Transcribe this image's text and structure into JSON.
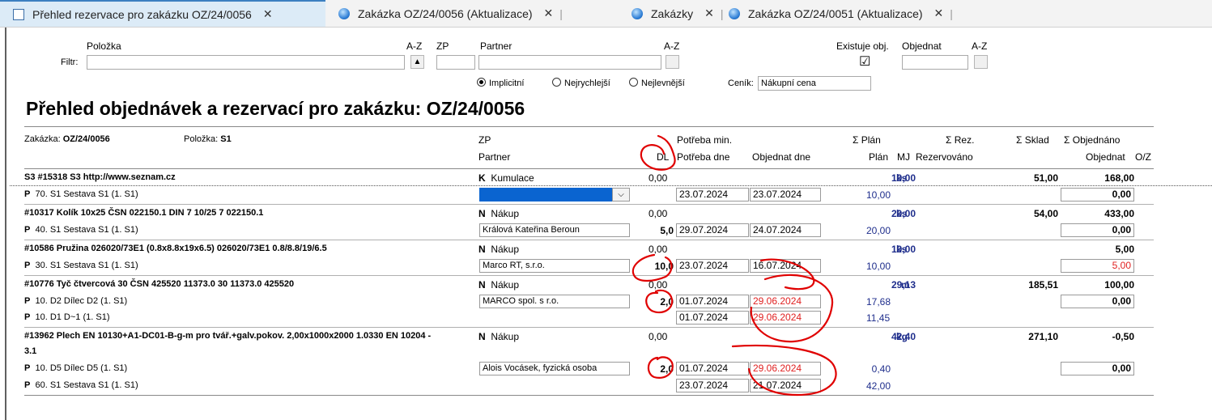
{
  "tabs": [
    {
      "label": "Přehled rezervace pro zakázku OZ/24/0056",
      "icon": "document-icon",
      "active": true
    },
    {
      "label": "Zakázka OZ/24/0056 (Aktualizace)",
      "icon": "globe-icon"
    },
    {
      "label": "Zakázky",
      "icon": "globe-icon"
    },
    {
      "label": "Zakázka OZ/24/0051 (Aktualizace)",
      "icon": "globe-icon"
    }
  ],
  "filter": {
    "filtr_label": "Filtr:",
    "polozka_label": "Položka",
    "az1": "A-Z",
    "zp_label": "ZP",
    "partner_label": "Partner",
    "az2": "A-Z",
    "existuje_label": "Existuje obj.",
    "objednat_label": "Objednat",
    "az3": "A-Z",
    "sort_up": "▲",
    "existuje_check": "☑",
    "radio_implicitni": "Implicitní",
    "radio_nejrychlejsi": "Nejrychlejší",
    "radio_nejlevnejsi": "Nejlevnější",
    "cenik_label": "Ceník:",
    "cenik_value": "Nákupní cena"
  },
  "title": "Přehled objednávek a rezervací pro zakázku: OZ/24/0056",
  "header": {
    "zakazka_label": "Zakázka:",
    "zakazka_value": "OZ/24/0056",
    "polozka_label": "Položka:",
    "polozka_value": "S1",
    "zp": "ZP",
    "partner": "Partner",
    "dl": "DL",
    "potreba_min": "Potřeba min.",
    "potreba_dne": "Potřeba dne",
    "objednat_dne": "Objednat dne",
    "plan_sum": "Σ  Plán",
    "plan": "Plán",
    "mj": "MJ",
    "rez_sum": "Σ  Rez.",
    "rezervovano": "Rezervováno",
    "sklad_sum": "Σ  Sklad",
    "objednano_sum": "Σ  Objednáno",
    "objednat": "Objednat",
    "oz": "O/Z"
  },
  "rows": [
    {
      "type": "item",
      "name": "S3 #15318 S3 http://www.seznam.cz",
      "zp": "K",
      "zp_text": "Kumulace",
      "dl": "0,00",
      "plan": "10,00",
      "mj": "ks",
      "sklad": "51,00",
      "objednano": "168,00"
    },
    {
      "type": "sub",
      "p": "P",
      "name": "70. S1 Sestava S1 (1. S1)",
      "partner": "",
      "dropdown": true,
      "potreba": "23.07.2024",
      "objednat_dne": "23.07.2024",
      "plan": "10,00",
      "objednat": "0,00"
    },
    {
      "type": "item",
      "name": "#10317 Kolík 10x25 ČSN 022150.1 DIN 7 10/25 7 022150.1",
      "zp": "N",
      "zp_text": "Nákup",
      "dl": "0,00",
      "plan": "20,00",
      "mj": "ks",
      "sklad": "54,00",
      "objednano": "433,00"
    },
    {
      "type": "sub",
      "p": "P",
      "name": "40. S1 Sestava S1 (1. S1)",
      "partner": "Králová Kateřina Beroun",
      "dl": "5,0",
      "potreba": "29.07.2024",
      "objednat_dne": "24.07.2024",
      "plan": "20,00",
      "objednat": "0,00"
    },
    {
      "type": "item",
      "name": "#10586 Pružina 026020/73E1 (0.8x8.8x19x6.5) 026020/73E1 0.8/8.8/19/6.5",
      "zp": "N",
      "zp_text": "Nákup",
      "dl": "0,00",
      "plan": "10,00",
      "mj": "ks",
      "sklad": "",
      "objednano": "5,00"
    },
    {
      "type": "sub",
      "p": "P",
      "name": "30. S1 Sestava S1 (1. S1)",
      "partner": "Marco RT, s.r.o.",
      "dl": "10,0",
      "potreba": "23.07.2024",
      "objednat_dne": "16.07.2024",
      "plan": "10,00",
      "objednat": "5,00",
      "objednat_red": true
    },
    {
      "type": "item",
      "name": "#10776 Tyč čtvercová 30 ČSN 425520 11373.0 30 11373.0 425520",
      "zp": "N",
      "zp_text": "Nákup",
      "dl": "0,00",
      "plan": "29,13",
      "mj": "m",
      "sklad": "185,51",
      "objednano": "100,00"
    },
    {
      "type": "sub",
      "p": "P",
      "name": "10. D2 Dílec D2 (1. S1)",
      "partner": "MARCO spol. s r.o.",
      "dl": "2,0",
      "potreba": "01.07.2024",
      "objednat_dne": "29.06.2024",
      "objednat_dne_red": true,
      "plan": "17,68",
      "objednat": "0,00"
    },
    {
      "type": "sub",
      "p": "P",
      "name": "10. D1 D~1 (1. S1)",
      "partner": "",
      "potreba": "01.07.2024",
      "objednat_dne": "29.06.2024",
      "objednat_dne_red": true,
      "plan": "11,45"
    },
    {
      "type": "item2",
      "name": "#13962 Plech EN 10130+A1-DC01-B-g-m pro tvář.+galv.pokov. 2,00x1000x2000 1.0330 EN 10204 -",
      "name2": "3.1",
      "zp": "N",
      "zp_text": "Nákup",
      "dl": "0,00",
      "plan": "42,40",
      "mj": "kg",
      "sklad": "271,10",
      "objednano": "-0,50"
    },
    {
      "type": "sub",
      "p": "P",
      "name": "10. D5 Dílec D5 (1. S1)",
      "partner": "Alois Vocásek, fyzická osoba",
      "dl": "2,0",
      "potreba": "01.07.2024",
      "objednat_dne": "29.06.2024",
      "objednat_dne_red": true,
      "plan": "0,40",
      "objednat": "0,00"
    },
    {
      "type": "sub",
      "p": "P",
      "name": "60. S1 Sestava S1 (1. S1)",
      "partner": "",
      "potreba": "23.07.2024",
      "objednat_dne": "21.07.2024",
      "plan": "42,00"
    }
  ]
}
